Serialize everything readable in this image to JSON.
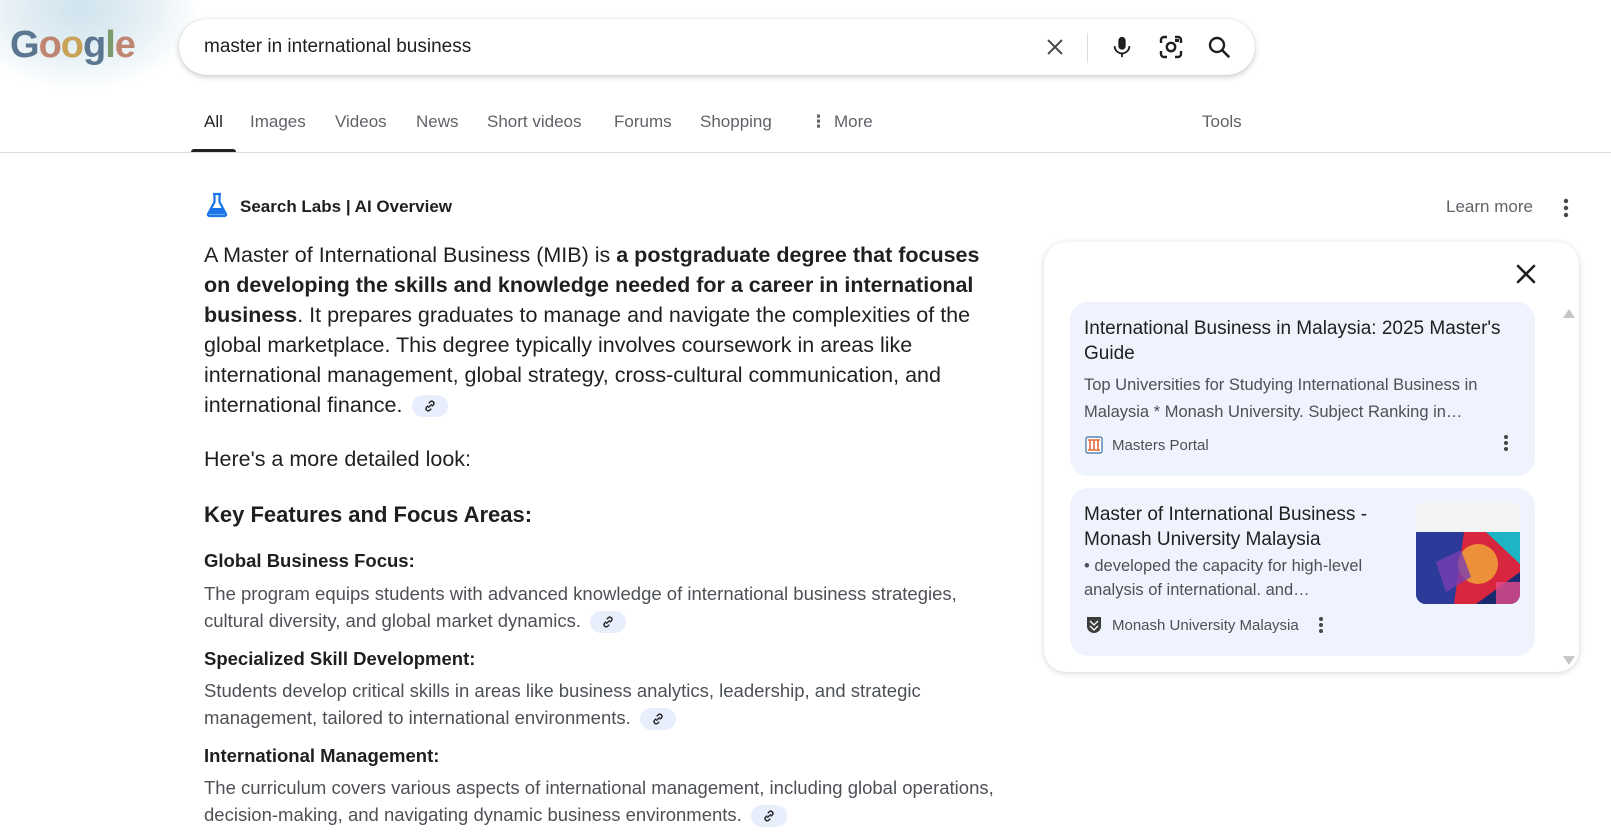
{
  "header": {
    "logo_text": "Google",
    "search": {
      "value": "master in international business",
      "clear_icon": "close-icon",
      "voice_icon": "microphone-icon",
      "lens_icon": "camera-lens-icon",
      "search_icon": "search-icon"
    }
  },
  "tabs": {
    "items": [
      {
        "label": "All",
        "active": true
      },
      {
        "label": "Images"
      },
      {
        "label": "Videos"
      },
      {
        "label": "News"
      },
      {
        "label": "Short videos"
      },
      {
        "label": "Forums"
      },
      {
        "label": "Shopping"
      },
      {
        "label": "More"
      }
    ],
    "tools_label": "Tools"
  },
  "ai_overview": {
    "labs_title": "Search Labs | AI Overview",
    "learn_more": "Learn more",
    "intro": {
      "lead": "A Master of International Business (MIB) is ",
      "bold": "a postgraduate degree that focuses on developing the skills and knowledge needed for a career in international business",
      "rest": ". It prepares graduates to manage and navigate the complexities of the global marketplace. This degree typically involves coursework in areas like international management, global strategy, cross-cultural communication, and international finance."
    },
    "detail_line": "Here's a more detailed look:",
    "section_heading": "Key Features and Focus Areas:",
    "features": [
      {
        "heading": "Global Business Focus:",
        "text": "The program equips students with advanced knowledge of international business strategies, cultural diversity, and global market dynamics."
      },
      {
        "heading": "Specialized Skill Development:",
        "text": "Students develop critical skills in areas like business analytics, leadership, and strategic management, tailored to international environments."
      },
      {
        "heading": "International Management:",
        "text": "The curriculum covers various aspects of international management, including global operations, decision-making, and navigating dynamic business environments."
      }
    ]
  },
  "side_panel": {
    "cards": [
      {
        "title": "International Business in Malaysia: 2025 Master's Guide",
        "snippet": "Top Universities for Studying International Business in Malaysia * Monash University. Subject Ranking in…",
        "source": "Masters Portal"
      },
      {
        "title": "Master of International Business - Monash University Malaysia",
        "snippet": "• developed the capacity for high-level analysis of international. and…",
        "source": "Monash University Malaysia"
      }
    ]
  },
  "colors": {
    "accent_blue": "#1a73e8",
    "card_bg": "#eef3fd",
    "chip_bg": "#e8eefc",
    "muted_text": "#5f6368"
  }
}
